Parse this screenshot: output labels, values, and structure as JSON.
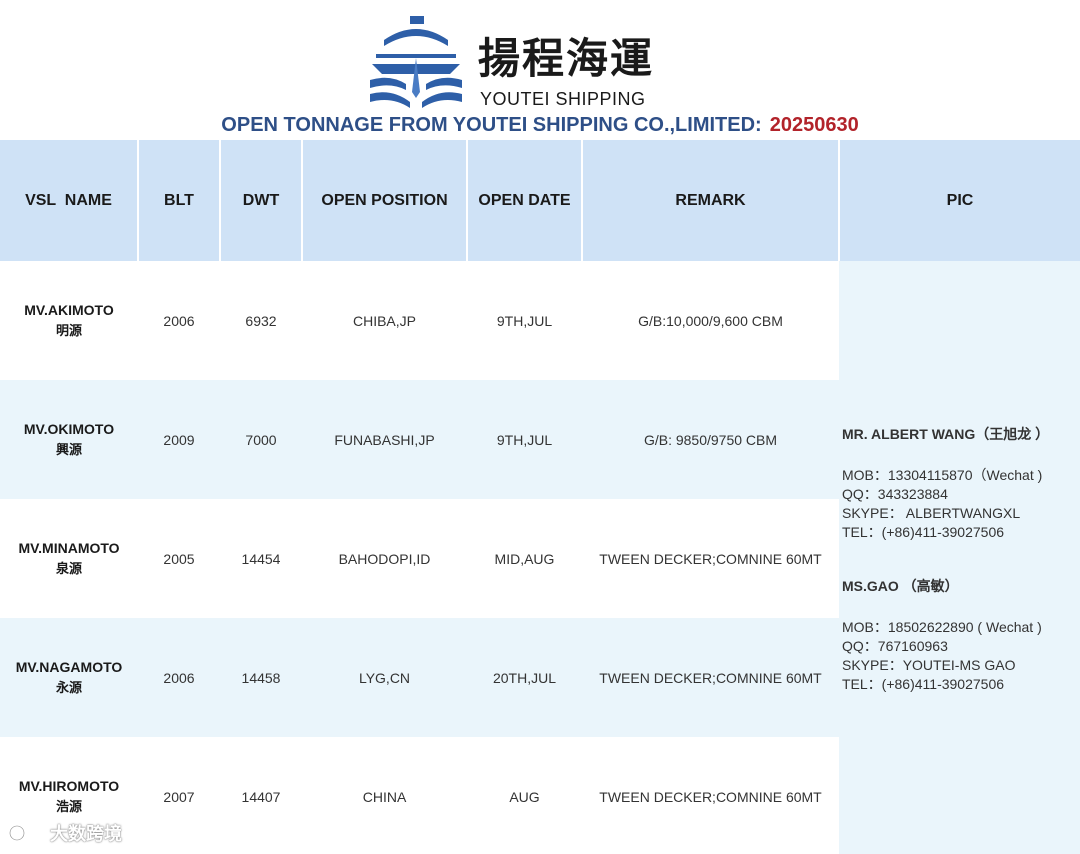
{
  "brand": {
    "name_cn": "揚程海運",
    "name_en": "YOUTEI SHIPPING"
  },
  "title": {
    "text": "OPEN TONNAGE FROM YOUTEI SHIPPING CO.,LIMITED:",
    "date": "20250630"
  },
  "colors": {
    "brand_blue": "#2e4f87",
    "date_red": "#b2232a",
    "header_bg": "#cfe2f6",
    "row_alt_bg": "#eaf5fb"
  },
  "table": {
    "headers": {
      "vsl_name": "VSL  NAME",
      "blt": "BLT",
      "dwt": "DWT",
      "open_position": "OPEN POSITION",
      "open_date": "OPEN DATE",
      "remark": "REMARK",
      "pic": "PIC"
    },
    "rows": [
      {
        "vsl_en": "MV.AKIMOTO",
        "vsl_cn": "明源",
        "blt": "2006",
        "dwt": "6932",
        "open_position": "CHIBA,JP",
        "open_date": "9TH,JUL",
        "remark": "G/B:10,000/9,600 CBM"
      },
      {
        "vsl_en": "MV.OKIMOTO",
        "vsl_cn": "興源",
        "blt": "2009",
        "dwt": "7000",
        "open_position": "FUNABASHI,JP",
        "open_date": "9TH,JUL",
        "remark": "G/B: 9850/9750 CBM"
      },
      {
        "vsl_en": "MV.MINAMOTO",
        "vsl_cn": "泉源",
        "blt": "2005",
        "dwt": "14454",
        "open_position": "BAHODOPI,ID",
        "open_date": "MID,AUG",
        "remark": "TWEEN DECKER;COMNINE 60MT"
      },
      {
        "vsl_en": "MV.NAGAMOTO",
        "vsl_cn": "永源",
        "blt": "2006",
        "dwt": "14458",
        "open_position": "LYG,CN",
        "open_date": "20TH,JUL",
        "remark": "TWEEN DECKER;COMNINE 60MT"
      },
      {
        "vsl_en": "MV.HIROMOTO",
        "vsl_cn": "浩源",
        "blt": "2007",
        "dwt": "14407",
        "open_position": "CHINA",
        "open_date": "AUG",
        "remark": "TWEEN DECKER;COMNINE 60MT"
      }
    ],
    "pic": {
      "contacts": [
        {
          "name": "MR. ALBERT WANG（王旭龙 ）",
          "mob": "MOB：13304115870（Wechat )",
          "qq": "QQ：343323884",
          "skype": "SKYPE： ALBERTWANGXL",
          "tel": "TEL：(+86)411-39027506"
        },
        {
          "name": "MS.GAO （高敏）",
          "mob": "MOB：18502622890 ( Wechat )",
          "qq": "QQ：767160963",
          "skype": "SKYPE：YOUTEI-MS GAO",
          "tel": "TEL：(+86)411-39027506"
        }
      ]
    }
  },
  "watermark": {
    "text": "大数跨境"
  }
}
